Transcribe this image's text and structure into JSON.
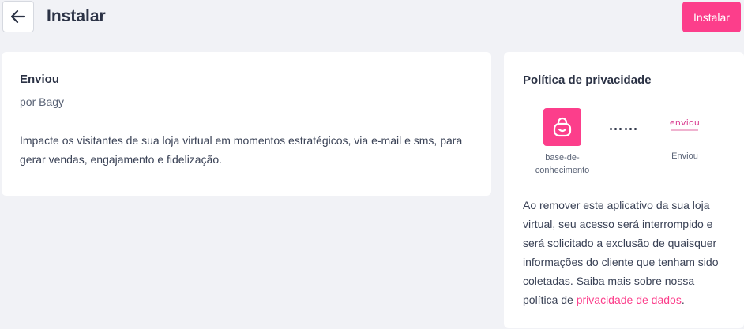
{
  "header": {
    "title": "Instalar",
    "install_label": "Instalar",
    "back_icon": "arrow-left-icon"
  },
  "app": {
    "name": "Enviou",
    "author": "por Bagy",
    "description": "Impacte os visitantes de sua loja virtual em momentos estratégicos, via e-mail e sms, para gerar vendas, engajamento e fidelização."
  },
  "privacy": {
    "title": "Política de privacidade",
    "source_app_label": "base-de-conhecimento",
    "source_app_icon": "shopping-bag-icon",
    "target_app_logo_text": "enviou",
    "target_app_label": "Enviou",
    "text_before_link": "Ao remover este aplicativo da sua loja virtual, seu acesso será interrompido e será solicitado a exclusão de quaisquer informações do cliente que tenham sido coletadas. Saiba mais sobre nossa política de ",
    "link_label": "privacidade de dados",
    "text_after_link": "."
  },
  "colors": {
    "accent": "#fc3e8b",
    "background": "#f1f2f6",
    "card": "#ffffff",
    "text": "#2b3245"
  }
}
